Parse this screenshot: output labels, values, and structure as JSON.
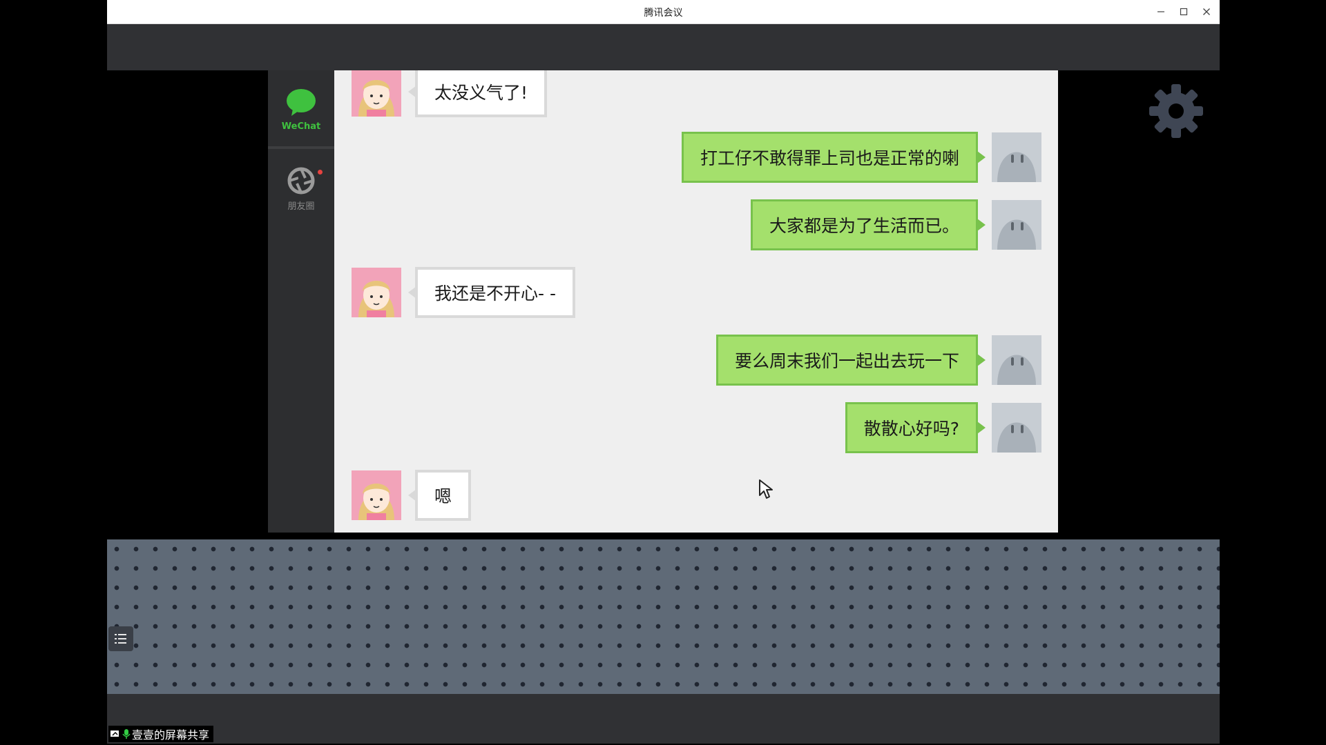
{
  "window": {
    "title": "腾讯会议"
  },
  "phone": {
    "tabs": [
      {
        "label": "WeChat",
        "icon": "chat-bubble-icon",
        "active": true
      },
      {
        "label": "朋友圈",
        "icon": "camera-shutter-icon",
        "active": false
      }
    ]
  },
  "chat": {
    "messages": [
      {
        "from": "other",
        "text": "太没义气了!"
      },
      {
        "from": "me",
        "text": "打工仔不敢得罪上司也是正常的喇"
      },
      {
        "from": "me",
        "text": "大家都是为了生活而已。"
      },
      {
        "from": "other",
        "text": "我还是不开心- -"
      },
      {
        "from": "me",
        "text": "要么周末我们一起出去玩一下"
      },
      {
        "from": "me",
        "text": "散散心好吗?"
      },
      {
        "from": "other",
        "text": "嗯"
      }
    ]
  },
  "share": {
    "label": "壹壹的屏幕共享"
  },
  "colors": {
    "wechat_green": "#3fc13f",
    "bubble_green": "#a4e06c",
    "bubble_border": "#78c24c",
    "panel_bg": "#efefef"
  }
}
